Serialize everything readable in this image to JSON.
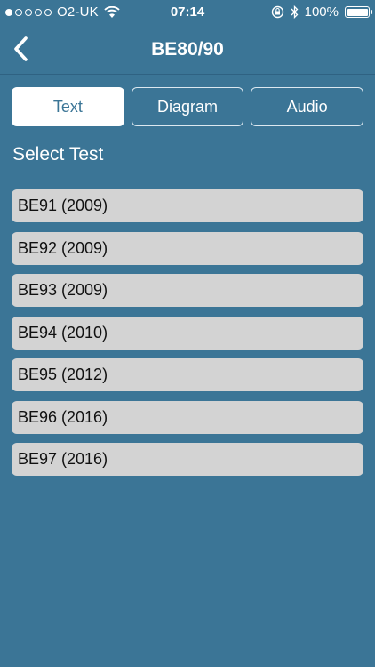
{
  "status_bar": {
    "carrier": "O2-UK",
    "time": "07:14",
    "battery": "100%",
    "signal_bars_filled": 1,
    "signal_bars_total": 5
  },
  "nav": {
    "title": "BE80/90",
    "back_icon": "chevron-left-icon"
  },
  "tabs": [
    {
      "label": "Text",
      "active": true
    },
    {
      "label": "Diagram",
      "active": false
    },
    {
      "label": "Audio",
      "active": false
    }
  ],
  "section_title": "Select Test",
  "tests": [
    {
      "label": "BE91 (2009)"
    },
    {
      "label": "BE92 (2009)"
    },
    {
      "label": "BE93 (2009)"
    },
    {
      "label": "BE94 (2010)"
    },
    {
      "label": "BE95 (2012)"
    },
    {
      "label": "BE96 (2016)"
    },
    {
      "label": "BE97 (2016)"
    }
  ],
  "colors": {
    "background": "#3b7596",
    "list_item": "#d3d3d3",
    "accent": "#ffffff"
  }
}
